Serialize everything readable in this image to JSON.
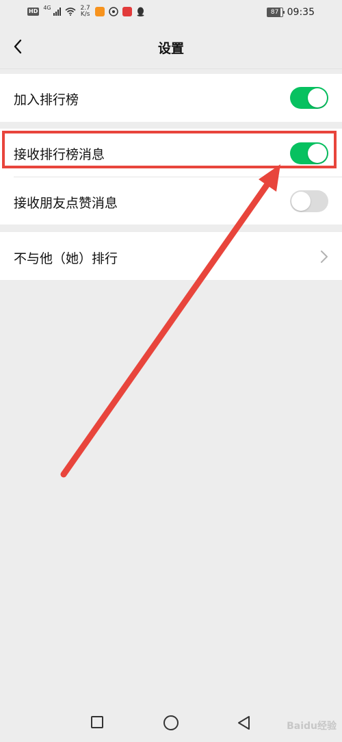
{
  "status_bar": {
    "hd": "HD",
    "network": "4G",
    "speed_value": "2.7",
    "speed_unit": "K/s",
    "battery": "87",
    "time": "09:35"
  },
  "navbar": {
    "title": "设置"
  },
  "settings": {
    "items": [
      {
        "label": "加入排行榜",
        "toggle": "on"
      },
      {
        "label": "接收排行榜消息",
        "toggle": "on"
      },
      {
        "label": "接收朋友点赞消息",
        "toggle": "off"
      },
      {
        "label": "不与他（她）排行"
      }
    ]
  },
  "annotation": {
    "color": "#e8453c"
  },
  "watermark": "Baidu经验",
  "colors": {
    "accent_green": "#07c160",
    "background": "#ededed"
  }
}
